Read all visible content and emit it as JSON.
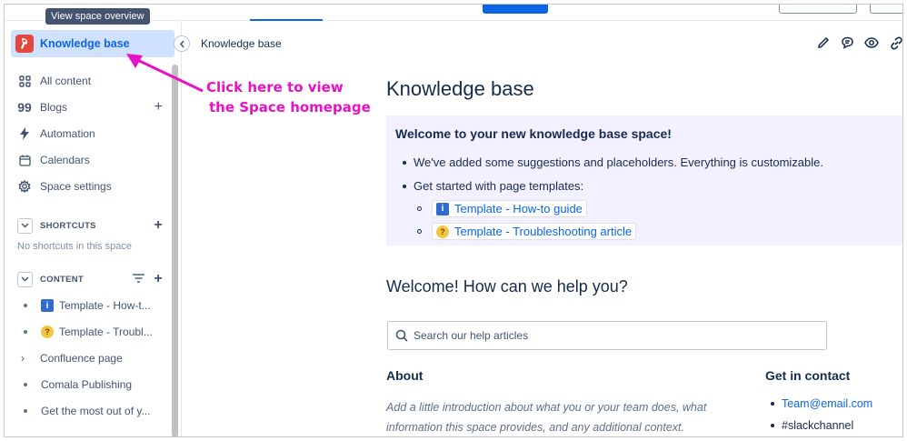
{
  "tooltip": "View space overview",
  "sidebar": {
    "space_name": "Knowledge base",
    "nav": [
      {
        "label": "All content",
        "icon": "grid-icon"
      },
      {
        "label": "Blogs",
        "icon": "quote-icon"
      },
      {
        "label": "Automation",
        "icon": "lightning-icon"
      },
      {
        "label": "Calendars",
        "icon": "calendar-icon"
      },
      {
        "label": "Space settings",
        "icon": "gear-icon"
      }
    ],
    "shortcuts_label": "SHORTCUTS",
    "shortcuts_empty": "No shortcuts in this space",
    "content_label": "CONTENT",
    "tree": [
      {
        "label": "Template - How-t...",
        "marker": "info-emoji"
      },
      {
        "label": "Template - Troubl...",
        "marker": "thinking-emoji"
      },
      {
        "label": "Confluence page",
        "marker": "chevron"
      },
      {
        "label": "Comala Publishing",
        "marker": "bullet"
      },
      {
        "label": "Get the most out of y...",
        "marker": "bullet"
      }
    ]
  },
  "breadcrumb": "Knowledge base",
  "page": {
    "title": "Knowledge base",
    "panel": {
      "title": "Welcome to your new knowledge base space!",
      "bullet1": "We've added some suggestions and placeholders. Everything is customizable.",
      "bullet2": "Get started with page templates:",
      "link1": "Template - How-to guide",
      "link2": "Template - Troubleshooting article"
    },
    "help_heading": "Welcome! How can we help you?",
    "search_placeholder": "Search our help articles",
    "about_heading": "About",
    "about_text": "Add a little introduction about what you or your team does, what information this space provides, and any additional context.",
    "contact_heading": "Get in contact",
    "contact_email": "Team@email.com",
    "contact_slack": "#slackchannel"
  },
  "annotation": {
    "line1": "Click here to view",
    "line2": "the Space homepage",
    "color": "#e612c6"
  },
  "colors": {
    "accent": "#0c66e4",
    "selected_bg": "#cfe1fd",
    "panel_bg": "#f3f0ff",
    "logo": "#e2483d"
  }
}
